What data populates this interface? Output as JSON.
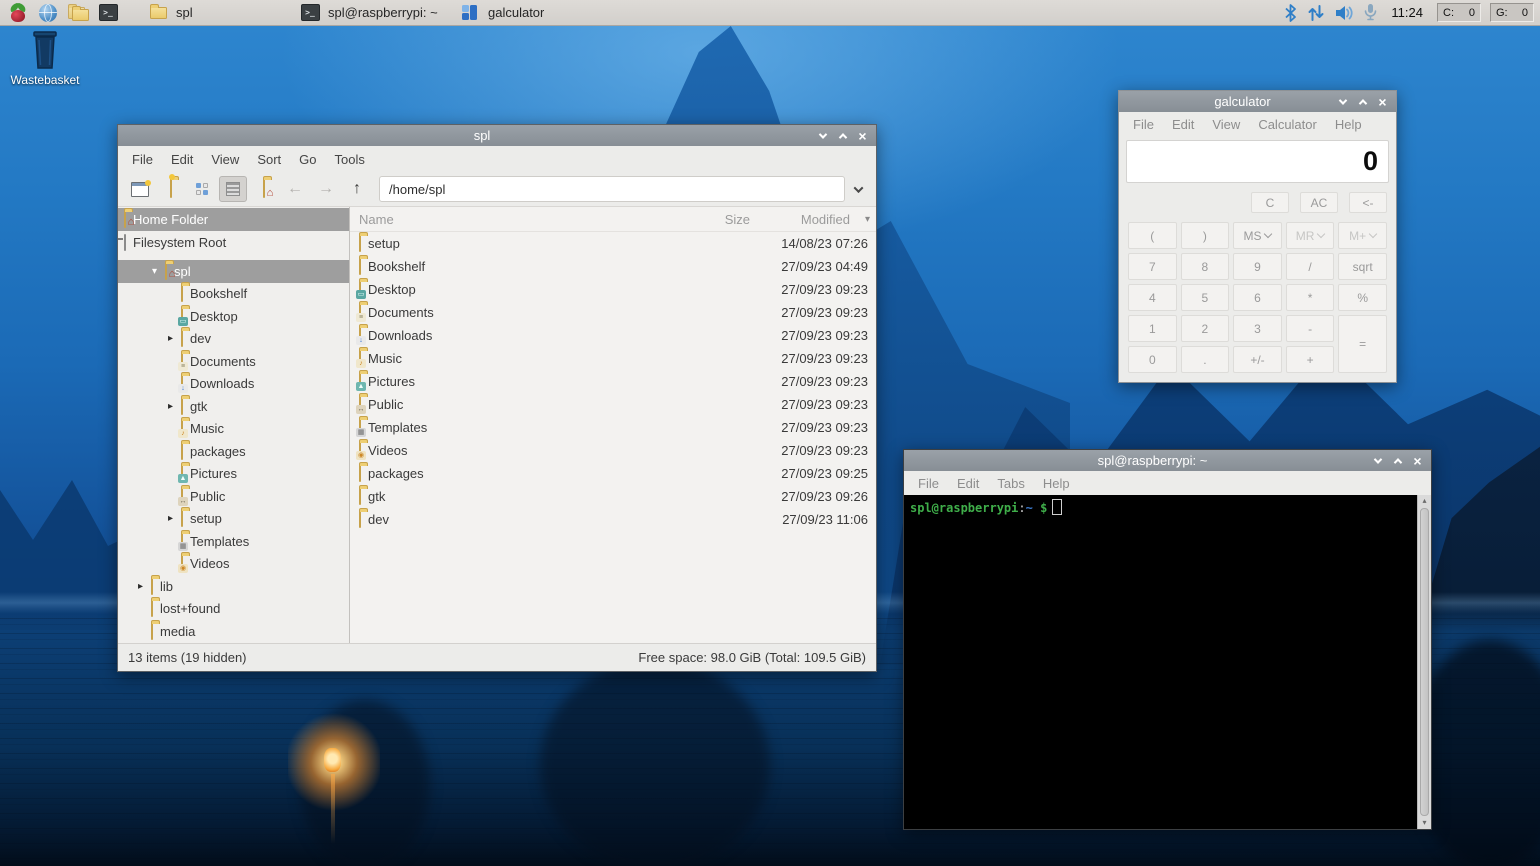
{
  "taskbar": {
    "launchers": [
      "menu",
      "web-browser",
      "file-manager",
      "terminal"
    ],
    "windows": [
      {
        "label": "spl",
        "icon": "folder"
      },
      {
        "label": "spl@raspberrypi: ~",
        "icon": "terminal"
      },
      {
        "label": "galculator",
        "icon": "calculator"
      }
    ],
    "tray": {
      "icons": [
        "bluetooth",
        "network-updown",
        "volume",
        "microphone"
      ],
      "clock": "11:24",
      "cpu": {
        "label": "C:",
        "value": "0"
      },
      "gpu": {
        "label": "G:",
        "value": "0"
      }
    }
  },
  "desktop": {
    "wastebasket_label": "Wastebasket"
  },
  "file_manager": {
    "title": "spl",
    "menu": [
      "File",
      "Edit",
      "View",
      "Sort",
      "Go",
      "Tools"
    ],
    "path": "/home/spl",
    "places": [
      {
        "label": "Home Folder",
        "icon": "home-folder",
        "selected": "true",
        "emblem": "home"
      },
      {
        "label": "Filesystem Root",
        "icon": "drive",
        "selected": "false",
        "emblem": "none"
      }
    ],
    "tree": [
      {
        "label": "spl",
        "level": "1",
        "expander": "open",
        "emblem": "home",
        "selected": "true"
      },
      {
        "label": "Bookshelf",
        "level": "2",
        "expander": "none",
        "emblem": "none",
        "selected": "false"
      },
      {
        "label": "Desktop",
        "level": "2",
        "expander": "none",
        "emblem": "desktop",
        "selected": "false"
      },
      {
        "label": "dev",
        "level": "2",
        "expander": "closed",
        "emblem": "none",
        "selected": "false"
      },
      {
        "label": "Documents",
        "level": "2",
        "expander": "none",
        "emblem": "documents",
        "selected": "false"
      },
      {
        "label": "Downloads",
        "level": "2",
        "expander": "none",
        "emblem": "downloads",
        "selected": "false"
      },
      {
        "label": "gtk",
        "level": "2",
        "expander": "closed",
        "emblem": "none",
        "selected": "false"
      },
      {
        "label": "Music",
        "level": "2",
        "expander": "none",
        "emblem": "music",
        "selected": "false"
      },
      {
        "label": "packages",
        "level": "2",
        "expander": "none",
        "emblem": "none",
        "selected": "false"
      },
      {
        "label": "Pictures",
        "level": "2",
        "expander": "none",
        "emblem": "pictures",
        "selected": "false"
      },
      {
        "label": "Public",
        "level": "2",
        "expander": "none",
        "emblem": "public",
        "selected": "false"
      },
      {
        "label": "setup",
        "level": "2",
        "expander": "closed",
        "emblem": "none",
        "selected": "false"
      },
      {
        "label": "Templates",
        "level": "2",
        "expander": "none",
        "emblem": "templates",
        "selected": "false"
      },
      {
        "label": "Videos",
        "level": "2",
        "expander": "none",
        "emblem": "videos",
        "selected": "false"
      },
      {
        "label": "lib",
        "level": "0",
        "expander": "closed",
        "emblem": "none",
        "selected": "false"
      },
      {
        "label": "lost+found",
        "level": "0",
        "expander": "none",
        "emblem": "none",
        "selected": "false"
      },
      {
        "label": "media",
        "level": "0",
        "expander": "none",
        "emblem": "none",
        "selected": "false"
      }
    ],
    "columns": {
      "name": "Name",
      "size": "Size",
      "modified": "Modified"
    },
    "files": [
      {
        "name": "setup",
        "size": "",
        "modified": "14/08/23 07:26",
        "emblem": "none"
      },
      {
        "name": "Bookshelf",
        "size": "",
        "modified": "27/09/23 04:49",
        "emblem": "none"
      },
      {
        "name": "Desktop",
        "size": "",
        "modified": "27/09/23 09:23",
        "emblem": "desktop"
      },
      {
        "name": "Documents",
        "size": "",
        "modified": "27/09/23 09:23",
        "emblem": "documents"
      },
      {
        "name": "Downloads",
        "size": "",
        "modified": "27/09/23 09:23",
        "emblem": "downloads"
      },
      {
        "name": "Music",
        "size": "",
        "modified": "27/09/23 09:23",
        "emblem": "music"
      },
      {
        "name": "Pictures",
        "size": "",
        "modified": "27/09/23 09:23",
        "emblem": "pictures"
      },
      {
        "name": "Public",
        "size": "",
        "modified": "27/09/23 09:23",
        "emblem": "public"
      },
      {
        "name": "Templates",
        "size": "",
        "modified": "27/09/23 09:23",
        "emblem": "templates"
      },
      {
        "name": "Videos",
        "size": "",
        "modified": "27/09/23 09:23",
        "emblem": "videos"
      },
      {
        "name": "packages",
        "size": "",
        "modified": "27/09/23 09:25",
        "emblem": "none"
      },
      {
        "name": "gtk",
        "size": "",
        "modified": "27/09/23 09:26",
        "emblem": "none"
      },
      {
        "name": "dev",
        "size": "",
        "modified": "27/09/23 11:06",
        "emblem": "none"
      }
    ],
    "status_left": "13 items (19 hidden)",
    "status_right": "Free space: 98.0 GiB (Total: 109.5 GiB)"
  },
  "calculator": {
    "title": "galculator",
    "menu": [
      "File",
      "Edit",
      "View",
      "Calculator",
      "Help"
    ],
    "display": "0",
    "clear_keys": [
      "C",
      "AC",
      "<-"
    ],
    "keys": [
      {
        "label": "(",
        "dropdown": "false",
        "dim": "false",
        "tall": "false"
      },
      {
        "label": ")",
        "dropdown": "false",
        "dim": "false",
        "tall": "false"
      },
      {
        "label": "MS",
        "dropdown": "true",
        "dim": "false",
        "tall": "false"
      },
      {
        "label": "MR",
        "dropdown": "true",
        "dim": "true",
        "tall": "false"
      },
      {
        "label": "M+",
        "dropdown": "true",
        "dim": "true",
        "tall": "false"
      },
      {
        "label": "7",
        "dropdown": "false",
        "dim": "false",
        "tall": "false"
      },
      {
        "label": "8",
        "dropdown": "false",
        "dim": "false",
        "tall": "false"
      },
      {
        "label": "9",
        "dropdown": "false",
        "dim": "false",
        "tall": "false"
      },
      {
        "label": "/",
        "dropdown": "false",
        "dim": "false",
        "tall": "false"
      },
      {
        "label": "sqrt",
        "dropdown": "false",
        "dim": "false",
        "tall": "false"
      },
      {
        "label": "4",
        "dropdown": "false",
        "dim": "false",
        "tall": "false"
      },
      {
        "label": "5",
        "dropdown": "false",
        "dim": "false",
        "tall": "false"
      },
      {
        "label": "6",
        "dropdown": "false",
        "dim": "false",
        "tall": "false"
      },
      {
        "label": "*",
        "dropdown": "false",
        "dim": "false",
        "tall": "false"
      },
      {
        "label": "%",
        "dropdown": "false",
        "dim": "false",
        "tall": "false"
      },
      {
        "label": "1",
        "dropdown": "false",
        "dim": "false",
        "tall": "false"
      },
      {
        "label": "2",
        "dropdown": "false",
        "dim": "false",
        "tall": "false"
      },
      {
        "label": "3",
        "dropdown": "false",
        "dim": "false",
        "tall": "false"
      },
      {
        "label": "-",
        "dropdown": "false",
        "dim": "false",
        "tall": "false"
      },
      {
        "label": "=",
        "dropdown": "false",
        "dim": "false",
        "tall": "true"
      },
      {
        "label": "0",
        "dropdown": "false",
        "dim": "false",
        "tall": "false"
      },
      {
        "label": ".",
        "dropdown": "false",
        "dim": "false",
        "tall": "false"
      },
      {
        "label": "+/-",
        "dropdown": "false",
        "dim": "false",
        "tall": "false"
      },
      {
        "label": "+",
        "dropdown": "false",
        "dim": "false",
        "tall": "false"
      }
    ]
  },
  "terminal": {
    "title": "spl@raspberrypi: ~",
    "menu": [
      "File",
      "Edit",
      "Tabs",
      "Help"
    ],
    "prompt": {
      "user": "spl@raspberrypi",
      "separator": ":",
      "path": "~",
      "symbol": "$"
    }
  }
}
